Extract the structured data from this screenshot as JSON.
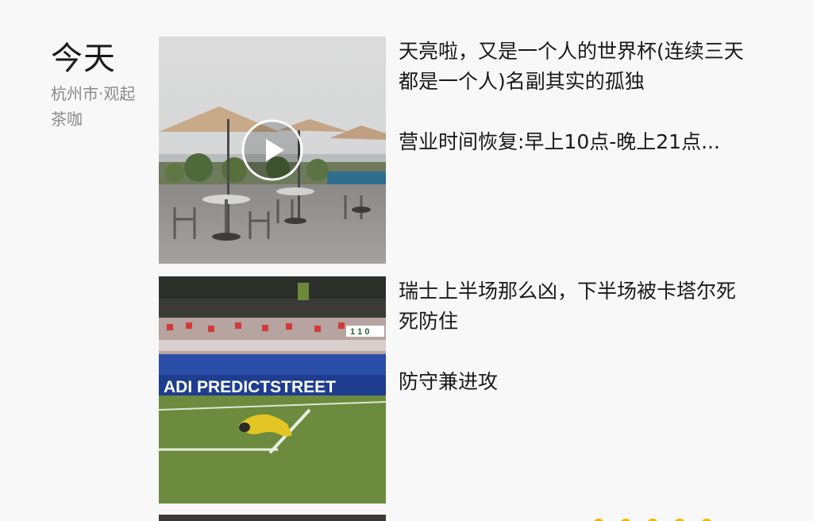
{
  "header": {
    "date_label": "今天",
    "location": "杭州市·观起茶咖"
  },
  "posts": [
    {
      "media_type": "video",
      "media_icon": "play-icon",
      "text_line1": "天亮啦，又是一个人的世界杯(连续三天都是一个人)名副其实的孤独",
      "text_line2": "营业时间恢复:早上10点-晚上21点..."
    },
    {
      "media_type": "photo",
      "banner_text": "ADI PREDICTSTREET",
      "scoreboard": "1 1 0",
      "text_line1": "瑞士上半场那么凶，下半场被卡塔尔死死防住",
      "text_line2": "防守兼进攻"
    }
  ],
  "colors": {
    "background": "#f8f8f8",
    "location_gray": "#8a8a8a",
    "emoji_yellow": "#f4b400"
  }
}
